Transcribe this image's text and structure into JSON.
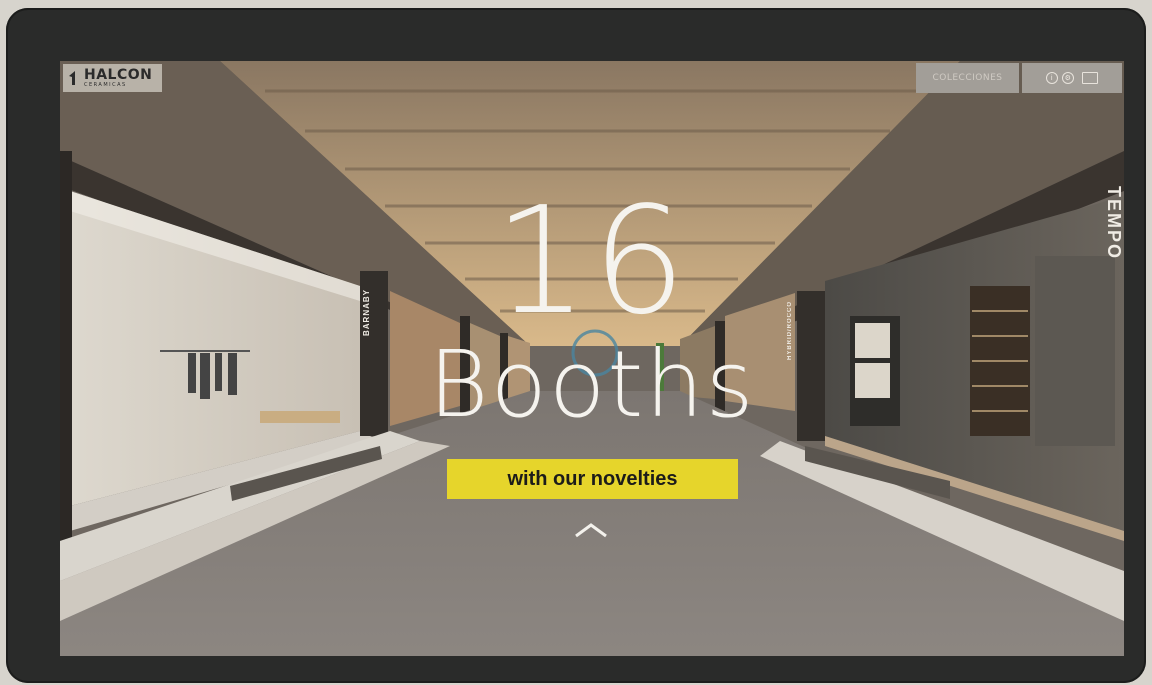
{
  "logo": {
    "brand": "HALCON",
    "sub": "CERAMICAS"
  },
  "nav": {
    "collections_label": "COLECCIONES"
  },
  "hero": {
    "number": "16",
    "word": "Booths",
    "cta_label": "with our novelties"
  },
  "booths": {
    "left_label": "BARNABY",
    "right_label": "HYBRID/ROCCO",
    "far_right_label": "TEMPO"
  },
  "colors": {
    "accent_yellow": "#e6d52b",
    "frame": "#2a2b2a",
    "text_light": "#f5f3ee"
  }
}
